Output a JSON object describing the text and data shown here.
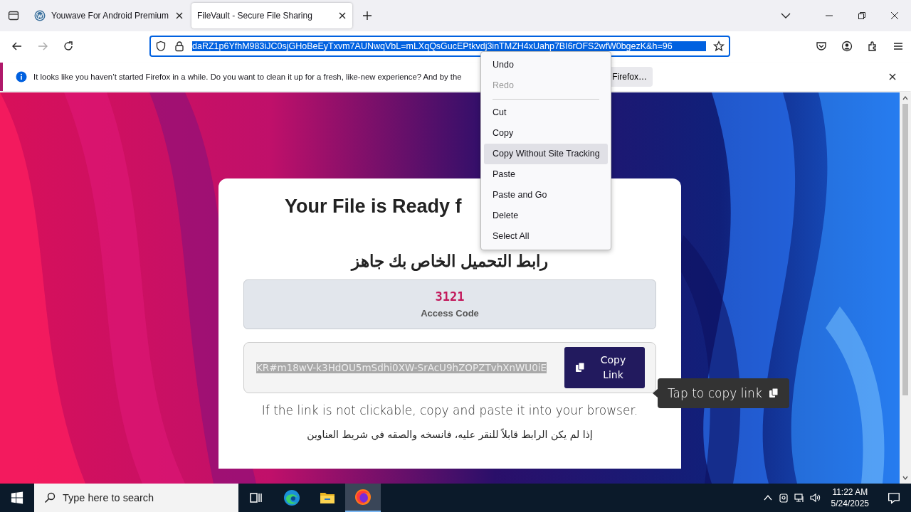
{
  "browser": {
    "tabs": [
      {
        "title": "Youwave For Android Premium",
        "selected": false
      },
      {
        "title": "FileVault - Secure File Sharing",
        "selected": true
      }
    ],
    "address_bar": {
      "value": "daRZ1p6YfhM983iJC0sjGHoBeEyTxvm7AUNwqVbL=mLXqQsGucEPtkvdj3inTMZH4xUahp7BI6rOFS2wfW0bgezK&h=96",
      "selected": true
    },
    "notification": {
      "message": "It looks like you haven’t started Firefox in a while. Do you want to clean it up for a fresh, like-new experience? And by the",
      "button": "Firefox…"
    }
  },
  "context_menu": {
    "items": [
      {
        "kind": "item",
        "label": "Undo",
        "disabled": false,
        "selected": false
      },
      {
        "kind": "item",
        "label": "Redo",
        "disabled": true,
        "selected": false
      },
      {
        "kind": "separator"
      },
      {
        "kind": "item",
        "label": "Cut",
        "disabled": false,
        "selected": false
      },
      {
        "kind": "item",
        "label": "Copy",
        "disabled": false,
        "selected": false
      },
      {
        "kind": "item",
        "label": "Copy Without Site Tracking",
        "disabled": false,
        "selected": true
      },
      {
        "kind": "item",
        "label": "Paste",
        "disabled": false,
        "selected": false
      },
      {
        "kind": "item",
        "label": "Paste and Go",
        "disabled": false,
        "selected": false
      },
      {
        "kind": "item",
        "label": "Delete",
        "disabled": false,
        "selected": false
      },
      {
        "kind": "item",
        "label": "Select All",
        "disabled": false,
        "selected": false
      }
    ]
  },
  "page": {
    "heading": "Your File is Ready f",
    "heading_ar": "رابط التحميل الخاص بك جاهز",
    "access_code": {
      "code": "3121",
      "label": "Access Code"
    },
    "link": {
      "value": "KR#m18wV-k3HdOU5mSdhi0XW-SrAcU9hZOPZTvhXnWU0iE",
      "selected": true
    },
    "copy_button": "Copy Link",
    "tooltip": "Tap to copy link",
    "note": "If the link is not clickable, copy and paste it into your browser.",
    "note_ar": "إذا لم يكن الرابط قابلاً للنقر عليه، فانسخه والصقه في شريط العناوين"
  },
  "taskbar": {
    "search_placeholder": "Type here to search",
    "apps": [
      {
        "kind": "taskview",
        "active": false
      },
      {
        "kind": "edge",
        "active": false
      },
      {
        "kind": "explorer",
        "active": false
      },
      {
        "kind": "firefox",
        "active": true
      }
    ],
    "time": "11:22 AM",
    "date": "5/24/2025"
  }
}
